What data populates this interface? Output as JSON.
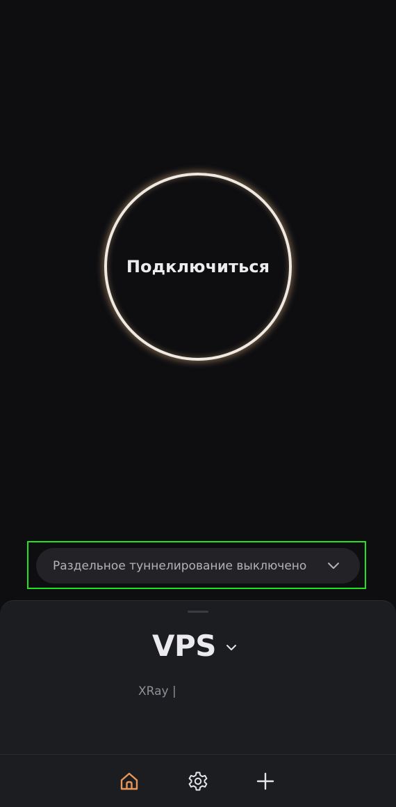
{
  "connect": {
    "label": "Подключиться"
  },
  "split_tunneling": {
    "label": "Раздельное туннелирование выключено",
    "icon": "chevron-down-icon"
  },
  "server": {
    "name": "VPS",
    "icon": "chevron-down-icon",
    "protocol": "XRay |"
  },
  "nav": {
    "items": [
      {
        "icon": "home-icon",
        "active": true
      },
      {
        "icon": "gear-icon",
        "active": false
      },
      {
        "icon": "plus-icon",
        "active": false
      }
    ]
  },
  "colors": {
    "background": "#0e0e11",
    "accent": "#e7975a",
    "highlight": "#22e31f",
    "sheet": "#1c1d21"
  }
}
